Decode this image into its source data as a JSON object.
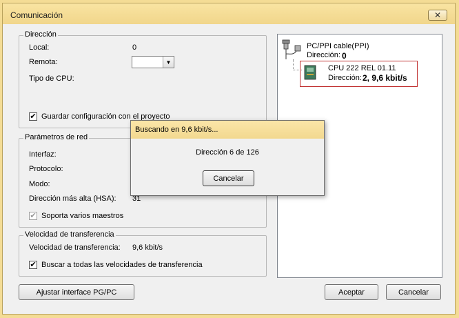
{
  "window": {
    "title": "Comunicación",
    "close_glyph": "✕"
  },
  "direccion_group": {
    "legend": "Dirección",
    "local_label": "Local:",
    "local_value": "0",
    "remota_label": "Remota:",
    "remota_value": "",
    "cpu_type_label": "Tipo de CPU:",
    "save_config_label": "Guardar configuración con el proyecto",
    "save_config_checked": true
  },
  "network_group": {
    "legend": "Parámetros de red",
    "interfaz_label": "Interfaz:",
    "protocolo_label": "Protocolo:",
    "modo_label": "Modo:",
    "hsa_label": "Dirección más alta (HSA):",
    "hsa_value": "31",
    "multi_master_label": "Soporta varios maestros",
    "multi_master_checked": true
  },
  "speed_group": {
    "legend": "Velocidad de transferencia",
    "speed_label": "Velocidad de transferencia:",
    "speed_value": "9,6 kbit/s",
    "search_all_label": "Buscar a todas las velocidades de transferencia",
    "search_all_checked": true
  },
  "tree": {
    "cable_label": "PC/PPI cable(PPI)",
    "cable_address_label": "Dirección:",
    "cable_address_value": "0",
    "cpu_label": "CPU 222 REL 01.11",
    "cpu_address_label": "Dirección:",
    "cpu_address_value": "2, 9,6 kbit/s"
  },
  "buttons": {
    "adjust": "Ajustar interface PG/PC",
    "accept": "Aceptar",
    "cancel": "Cancelar"
  },
  "search_dialog": {
    "title": "Buscando en 9,6 kbit/s...",
    "status": "Dirección 6 de 126",
    "cancel": "Cancelar"
  }
}
